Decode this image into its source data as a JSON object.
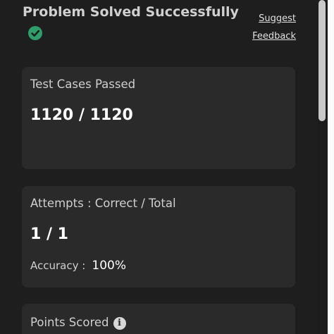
{
  "header": {
    "title": "Problem Solved Successfully",
    "status_icon": "check-circle-icon",
    "suggest_label": "Suggest",
    "feedback_label": "Feedback"
  },
  "colors": {
    "background": "#1e1e1e",
    "card": "#2a2a2a",
    "success": "#2e9e6a"
  },
  "test_cases": {
    "label": "Test Cases Passed",
    "value": "1120 / 1120"
  },
  "attempts": {
    "label": "Attempts : Correct / Total",
    "value": "1 / 1",
    "accuracy_label": "Accuracy :",
    "accuracy_value": "100%"
  },
  "points": {
    "label": "Points Scored",
    "info_icon": "info-icon"
  }
}
